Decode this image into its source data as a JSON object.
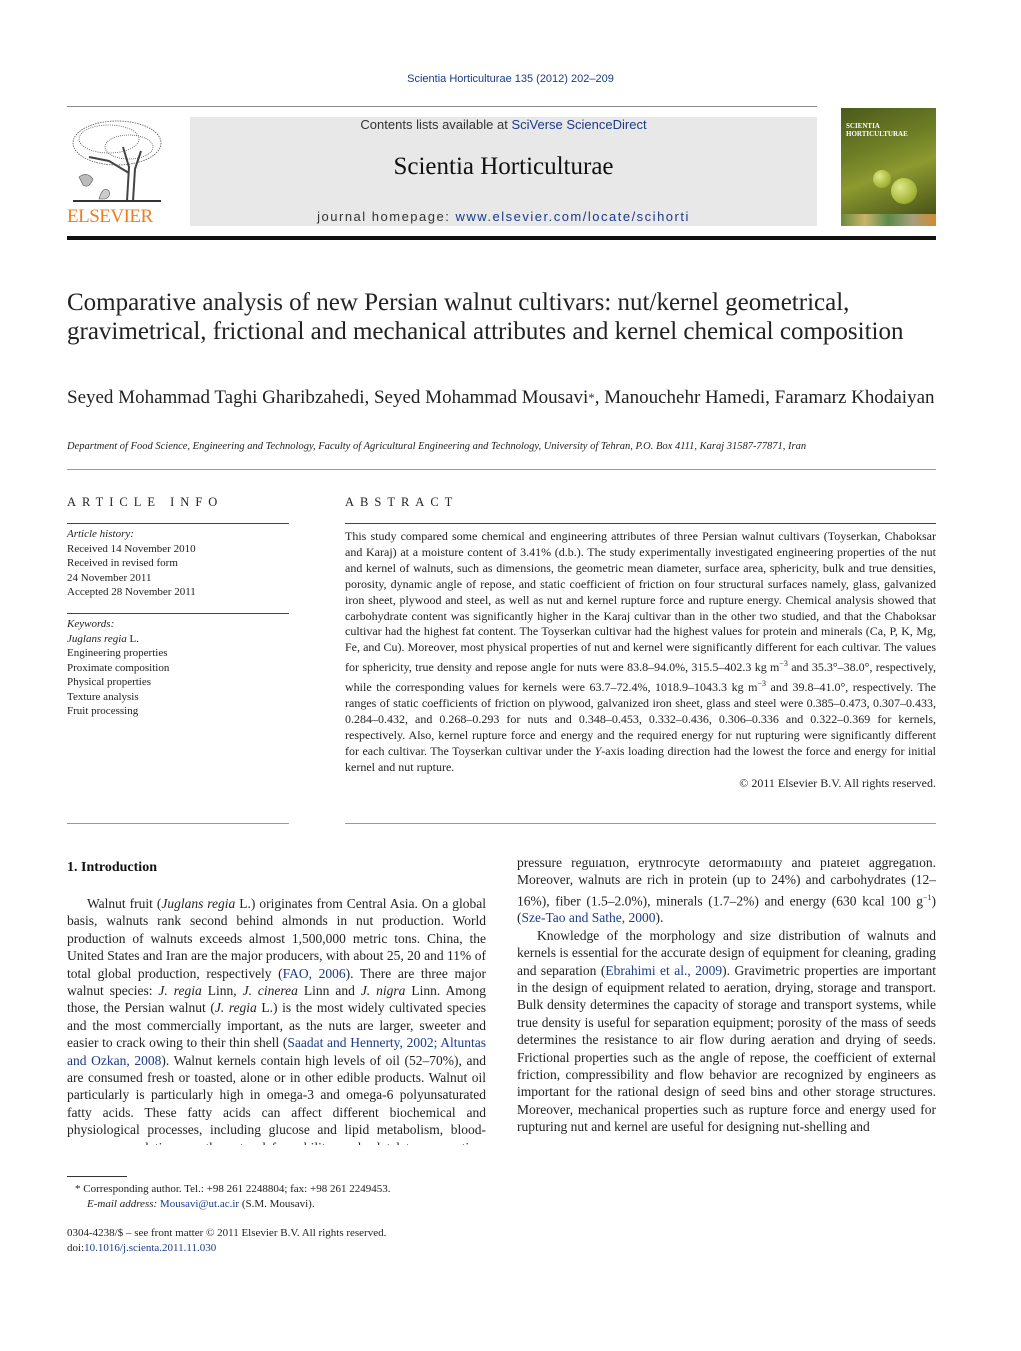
{
  "header": {
    "journal_ref": "Scientia Horticulturae 135 (2012) 202–209",
    "contents_prefix": "Contents lists available at ",
    "contents_link": "SciVerse ScienceDirect",
    "journal_title": "Scientia Horticulturae",
    "homepage_prefix": "journal homepage: ",
    "homepage_link": "www.elsevier.com/locate/scihorti",
    "publisher_logo_text": "ELSEVIER",
    "cover_title_line1": "SCIENTIA",
    "cover_title_line2": "HORTICULTURAE",
    "colors": {
      "link": "#1a3a8a",
      "elsevier_orange": "#f07d1c",
      "band": "#e8e8e8"
    }
  },
  "article": {
    "title": "Comparative analysis of new Persian walnut cultivars: nut/kernel geometrical, gravimetrical, frictional and mechanical attributes and kernel chemical composition",
    "authors_part1": "Seyed Mohammad Taghi Gharibzahedi, Seyed Mohammad Mousavi",
    "corresponding_mark": "*",
    "authors_part2": ", Manouchehr Hamedi, Faramarz Khodaiyan",
    "affiliation": "Department of Food Science, Engineering and Technology, Faculty of Agricultural Engineering and Technology, University of Tehran, P.O. Box 4111, Karaj 31587-77871, Iran"
  },
  "article_info": {
    "heading": "ARTICLE INFO",
    "history_label": "Article history:",
    "history": [
      "Received 14 November 2010",
      "Received in revised form",
      "24 November 2011",
      "Accepted 28 November 2011"
    ],
    "keywords_label": "Keywords:",
    "keyword_first_italic": "Juglans regia",
    "keyword_first_suffix": " L.",
    "keywords": [
      "Engineering properties",
      "Proximate composition",
      "Physical properties",
      "Texture analysis",
      "Fruit processing"
    ]
  },
  "abstract": {
    "heading": "ABSTRACT",
    "p1": "This study compared some chemical and engineering attributes of three Persian walnut cultivars (Toyserkan, Chaboksar and Karaj) at a moisture content of 3.41% (d.b.). The study experimentally investigated engineering properties of the nut and kernel of walnuts, such as dimensions, the geometric mean diameter, surface area, sphericity, bulk and true densities, porosity, dynamic angle of repose, and static coefficient of friction on four structural surfaces namely, glass, galvanized iron sheet, plywood and steel, as well as nut and kernel rupture force and rupture energy. Chemical analysis showed that carbohydrate content was significantly higher in the Karaj cultivar than in the other two studied, and that the Chaboksar cultivar had the highest fat content. The Toyserkan cultivar had the highest values for protein and minerals (Ca, P, K, Mg, Fe, and Cu). Moreover, most physical properties of nut and kernel were significantly different for each cultivar. The values for sphericity, true density and repose angle for nuts were 83.8–94.0%, 315.5–402.3 kg m",
    "exp1": "−3",
    "p2": " and 35.3°–38.0°, respectively, while the corresponding values for kernels were 63.7–72.4%, 1018.9–1043.3 kg m",
    "exp2": "−3",
    "p3": " and 39.8–41.0°, respectively. The ranges of static coefficients of friction on plywood, galvanized iron sheet, glass and steel were 0.385–0.473, 0.307–0.433, 0.284–0.432, and 0.268–0.293 for nuts and 0.348–0.453, 0.332–0.436, 0.306–0.336 and 0.322–0.369 for kernels, respectively. Also, kernel rupture force and energy and the required energy for nut rupturing were significantly different for each cultivar. The Toyserkan cultivar under the ",
    "italic_y": "Y",
    "p4": "-axis loading direction had the lowest the force and energy for initial kernel and nut rupture.",
    "copyright": "© 2011 Elsevier B.V. All rights reserved."
  },
  "intro": {
    "heading": "1.  Introduction",
    "l1a": "Walnut fruit (",
    "l1_it": "Juglans regia",
    "l1b": " L.) originates from Central Asia. On a global basis, walnuts rank second behind almonds in nut production. World production of walnuts exceeds almost 1,500,000 metric tons. China, the United States and Iran are the major producers, with about 25, 20 and 11% of total global production, respectively (",
    "ref_fao": "FAO, 2006",
    "l2a": "). There are three major walnut species: ",
    "sp1": "J. regia",
    "l2b": " Linn, ",
    "sp2": "J. cinerea",
    "l2c": " Linn and ",
    "sp3": "J. nigra",
    "l2d": " Linn. Among those, the Persian walnut (",
    "sp4": "J. regia",
    "l2e": " L.) is the most widely cultivated species and the most commercially important, as the nuts are larger, sweeter and easier to crack owing to their thin shell (",
    "ref_saadat": "Saadat and Hennerty, 2002; Altuntas and Ozkan, 2008",
    "l3": "). Walnut kernels contain high levels of oil (52–70%), and are consumed fresh or toasted, alone or in other edible products. Walnut oil particularly is particularly high in omega-3 and omega-6 polyunsaturated fatty acids. These fatty acids can affect different biochemical and physiological processes, including glucose and lipid metabolism, blood-pressure regulation, erythrocyte deformability and platelet aggregation. Moreover, walnuts are rich in protein (up to 24%) and carbohydrates (12–16%), fiber (1.5–2.0%), minerals (1.7–2%) and energy (630 kcal 100 g",
    "exp": "−1",
    "l3b": ") (",
    "ref_sze": "Sze-Tao and Sathe, 2000",
    "l3c": ").",
    "p2a": "Knowledge of the morphology and size distribution of walnuts and kernels is essential for the accurate design of equipment for cleaning, grading and separation (",
    "ref_ebr": "Ebrahimi et al., 2009",
    "p2b": "). Gravimetric properties are important in the design of equipment related to aeration, drying, storage and transport. Bulk density determines the capacity of storage and transport systems, while true density is useful for separation equipment; porosity of the mass of seeds determines the resistance to air flow during aeration and drying of seeds. Frictional properties such as the angle of repose, the coefficient of external friction, compressibility and flow behavior are recognized by engineers as important for the rational design of seed bins and other storage structures. Moreover, mechanical properties such as rupture force and energy used for rupturing nut and kernel are useful for designing nut-shelling and"
  },
  "footnote": {
    "star": "*",
    "text": " Corresponding author. Tel.: +98 261 2248804; fax: +98 261 2249453.",
    "email_label": "E-mail address: ",
    "email": "Mousavi@ut.ac.ir",
    "email_suffix": " (S.M. Mousavi).",
    "front_matter": "0304-4238/$ – see front matter © 2011 Elsevier B.V. All rights reserved.",
    "doi_label": "doi:",
    "doi": "10.1016/j.scienta.2011.11.030"
  }
}
